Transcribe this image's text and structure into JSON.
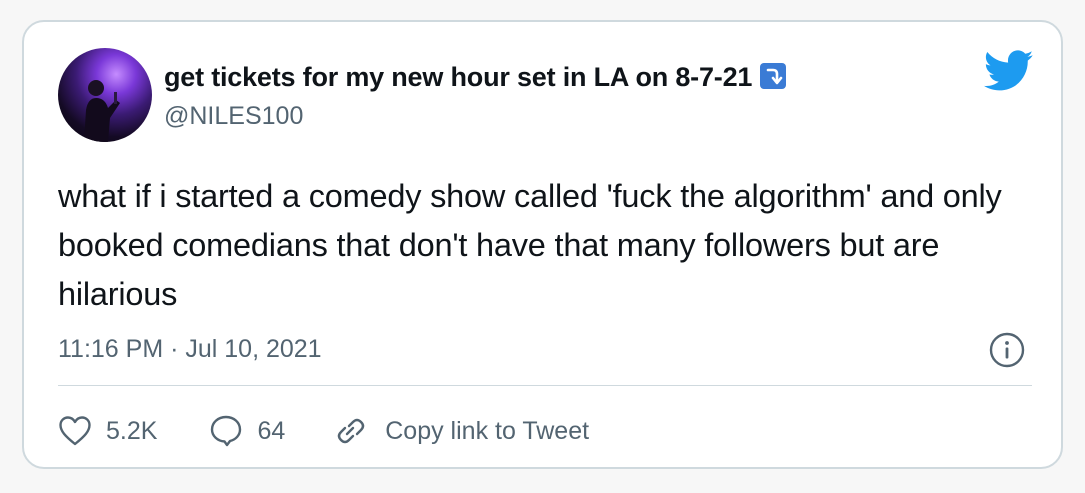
{
  "tweet": {
    "display_name": "get tickets for my new hour set in LA on 8-7-21",
    "display_name_emoji": "right-arrow-curving-down",
    "handle": "@NILES100",
    "text": "what if i started a comedy show called 'fuck the algorithm' and only booked comedians that don't have that many followers but are hilarious",
    "timestamp": "11:16 PM · Jul 10, 2021"
  },
  "actions": {
    "like_count": "5.2K",
    "reply_count": "64",
    "copy_link_label": "Copy link to Tweet"
  },
  "icons": {
    "brand": "twitter-bird-icon",
    "info": "info-icon",
    "like": "heart-icon",
    "reply": "speech-bubble-icon",
    "copy": "link-icon"
  },
  "colors": {
    "brand_blue": "#1d9bf0",
    "secondary_text": "#536471",
    "primary_text": "#0f1419",
    "border": "#cfd9de"
  }
}
